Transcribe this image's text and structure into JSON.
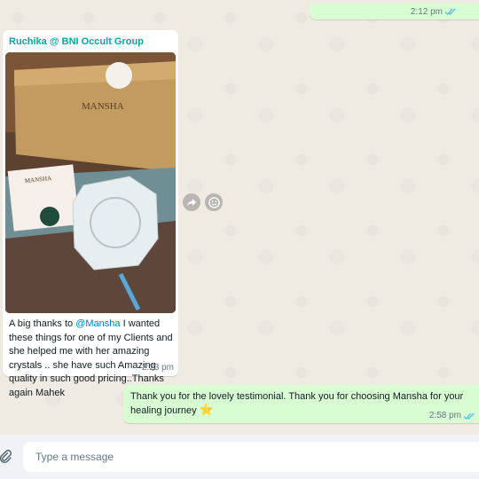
{
  "messages": {
    "top_outgoing": {
      "time": "2:12 pm"
    },
    "incoming": {
      "sender": "Ruchika @ BNI Occult Group",
      "text_before": "A big thanks to ",
      "mention": "@Mansha",
      "text_after": "  I wanted these things for one of my Clients and she helped me with her amazing crystals .. she have such Amazing quality in such good pricing..Thanks again Mahek",
      "time": "2:23 pm",
      "photo_box_text": "MANSHA",
      "photo_card_text": "MANSHA"
    },
    "bottom_outgoing": {
      "text": "Thank you for the lovely testimonial. Thank you for choosing Mansha for your healing journey",
      "emoji": "⭐",
      "time": "2:58 pm"
    }
  },
  "composer": {
    "placeholder": "Type a message"
  },
  "icons": {
    "forward": "forward-icon",
    "emoji": "emoji-icon",
    "attach": "attach-icon",
    "read_receipt": "double-check-icon"
  },
  "colors": {
    "outgoing_bubble": "#d9fdd3",
    "incoming_bubble": "#ffffff",
    "sender_name": "#06a59f",
    "mention": "#027eb5",
    "read_check": "#53bdeb"
  }
}
